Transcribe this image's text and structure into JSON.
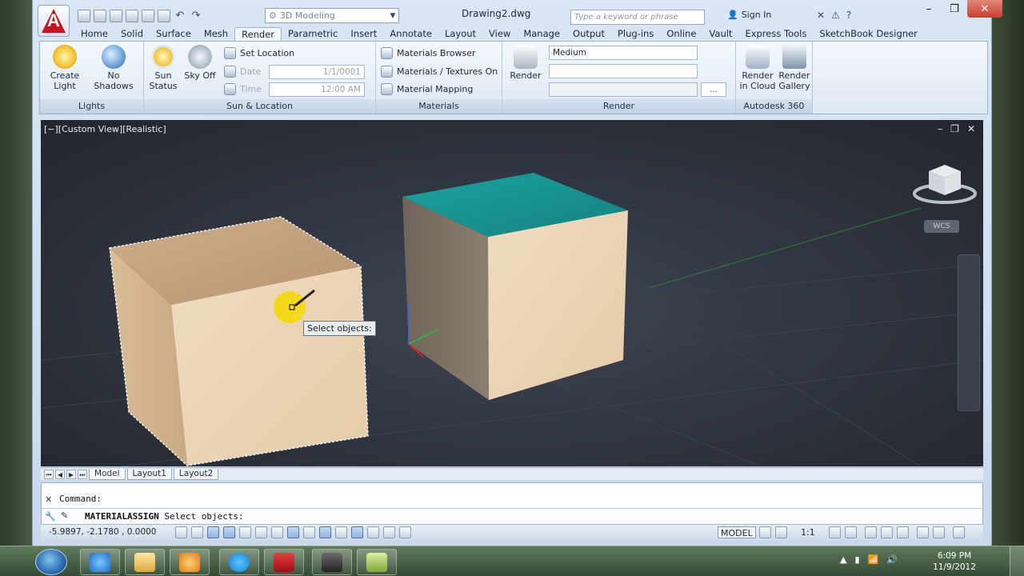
{
  "window": {
    "doc_title": "Drawing2.dwg",
    "workspace": "3D Modeling",
    "search_placeholder": "Type a keyword or phrase",
    "sign_in": "Sign In"
  },
  "tabs": [
    "Home",
    "Solid",
    "Surface",
    "Mesh",
    "Render",
    "Parametric",
    "Insert",
    "Annotate",
    "Layout",
    "View",
    "Manage",
    "Output",
    "Plug-ins",
    "Online",
    "Vault",
    "Express Tools",
    "SketchBook Designer"
  ],
  "ribbon": {
    "lights": {
      "title": "Lights",
      "create_light": "Create Light",
      "no_shadows": "No Shadows"
    },
    "sun": {
      "title": "Sun & Location",
      "sun_status": "Sun Status",
      "sky_off": "Sky Off",
      "set_location": "Set Location",
      "date_label": "Date",
      "date_value": "1/1/0001",
      "time_label": "Time",
      "time_value": "12:00 AM"
    },
    "materials": {
      "title": "Materials",
      "browser": "Materials Browser",
      "textures": "Materials / Textures On",
      "mapping": "Material Mapping"
    },
    "render": {
      "title": "Render",
      "render": "Render",
      "preset": "Medium",
      "ellipsis": "..."
    },
    "cloud": {
      "title": "Autodesk 360",
      "render_cloud": "Render in Cloud",
      "render_gallery": "Render Gallery"
    }
  },
  "viewport": {
    "label": "[−][Custom View][Realistic]",
    "tooltip": "Select objects:",
    "wcs": "WCS"
  },
  "layout_tabs": [
    "Model",
    "Layout1",
    "Layout2"
  ],
  "command": {
    "history": "Command:",
    "current_cmd": "MATERIALASSIGN",
    "current_prompt": "Select objects:"
  },
  "status": {
    "coords": "-5.9897, -2.1780 , 0.0000",
    "model": "MODEL",
    "scale": "1:1"
  },
  "taskbar": {
    "time": "6:09 PM",
    "date": "11/9/2012"
  },
  "colors": {
    "accent": "#c6141e",
    "viewport_bg": "#2e333c",
    "wood": "#e8cfae",
    "teal_top": "#1fa3a0"
  }
}
